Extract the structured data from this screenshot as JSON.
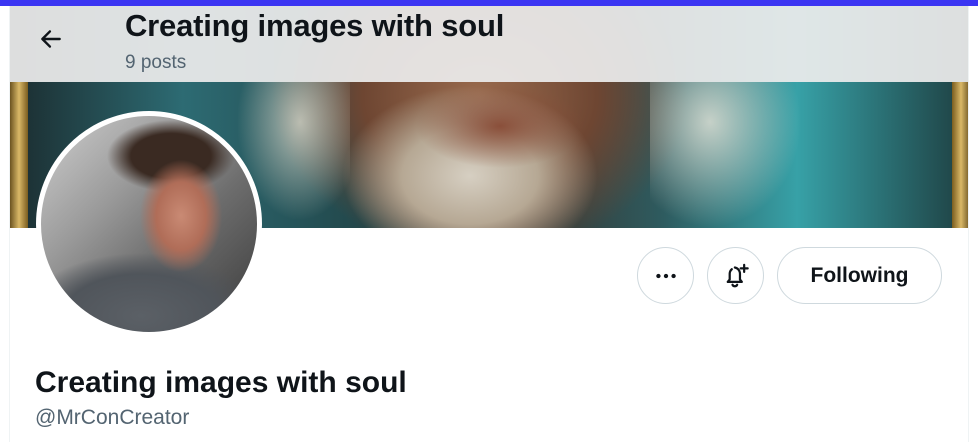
{
  "header": {
    "title": "Creating images with soul",
    "subtitle": "9 posts",
    "back_icon": "arrow-left-icon"
  },
  "profile": {
    "display_name": "Creating images with soul",
    "handle": "@MrConCreator"
  },
  "actions": {
    "more_icon": "ellipsis-icon",
    "notify_icon": "bell-plus-icon",
    "following_label": "Following"
  },
  "colors": {
    "accent_bar": "#3b35f2",
    "text_primary": "#0f1419",
    "text_secondary": "#536471",
    "button_border": "#cfd9de"
  }
}
